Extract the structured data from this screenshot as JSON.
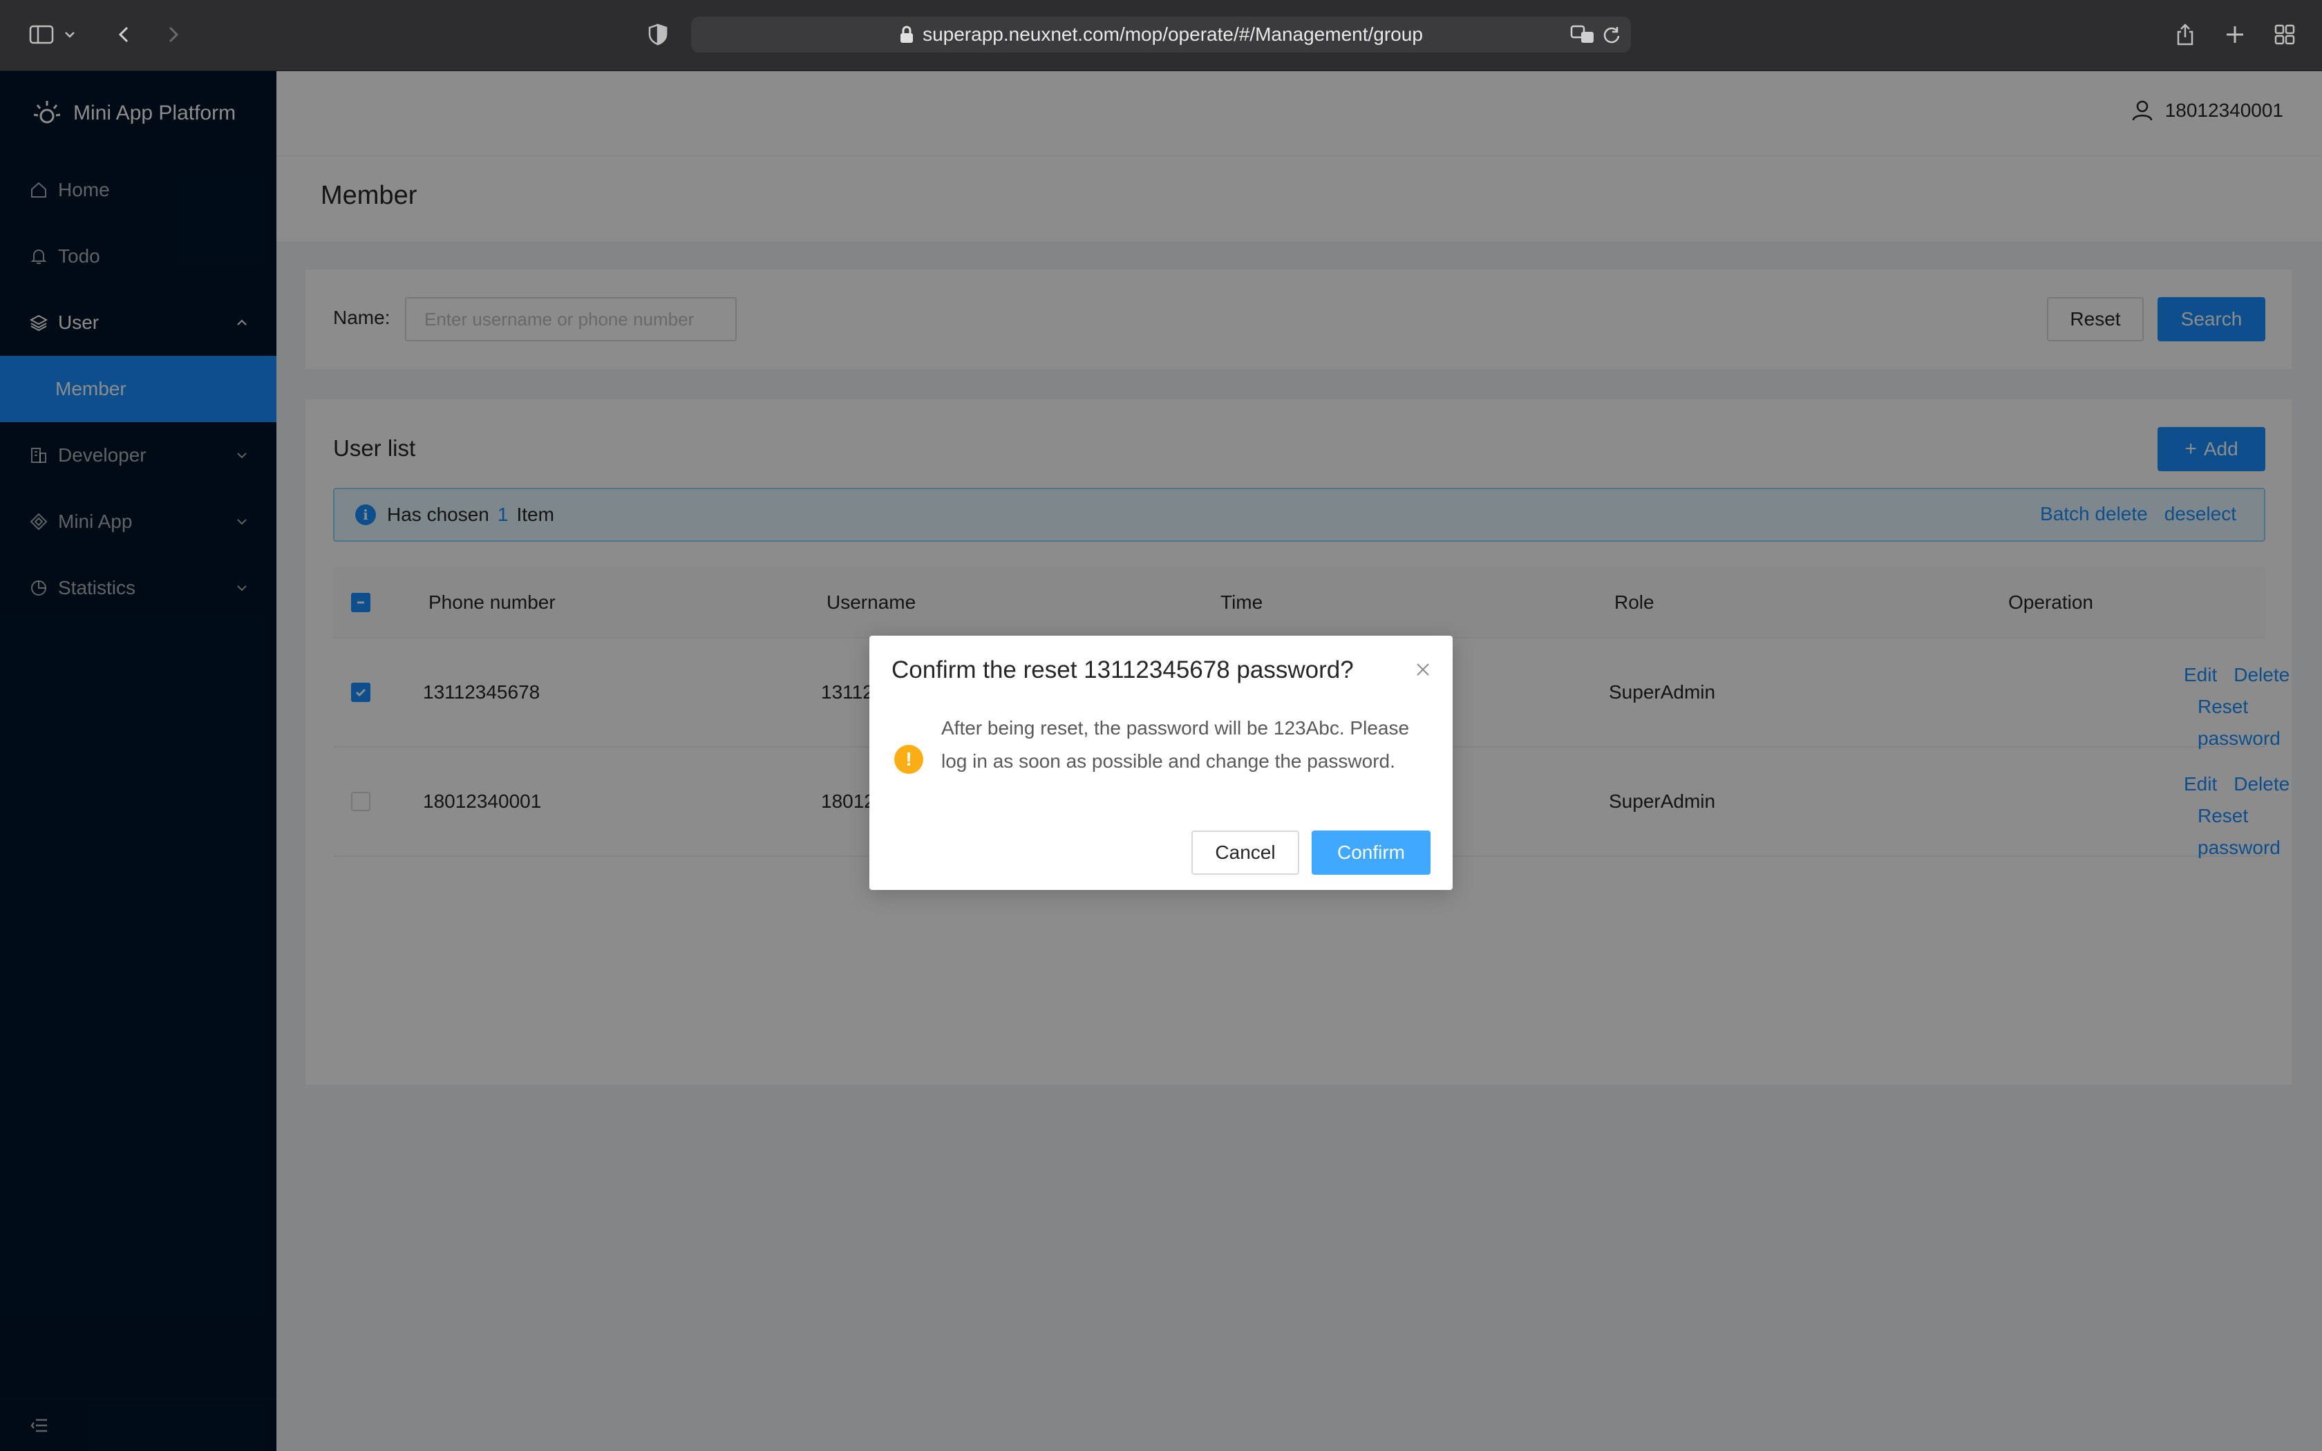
{
  "browser": {
    "url": "superapp.neuxnet.com/mop/operate/#/Management/group"
  },
  "sidebar": {
    "app_name": "Mini App Platform",
    "items": [
      {
        "label": "Home"
      },
      {
        "label": "Todo"
      },
      {
        "label": "User"
      },
      {
        "label": "Member"
      },
      {
        "label": "Developer"
      },
      {
        "label": "Mini App"
      },
      {
        "label": "Statistics"
      }
    ]
  },
  "topbar": {
    "username": "18012340001"
  },
  "page": {
    "title": "Member"
  },
  "search": {
    "label": "Name:",
    "placeholder": "Enter username or phone number",
    "reset_label": "Reset",
    "search_label": "Search"
  },
  "list": {
    "title": "User list",
    "add_label": "Add",
    "alert": {
      "prefix": "Has chosen",
      "count": "1",
      "suffix": "Item",
      "batch_delete": "Batch delete",
      "deselect": "deselect"
    },
    "columns": [
      "Phone number",
      "Username",
      "Time",
      "Role",
      "Operation"
    ],
    "rows": [
      {
        "phone": "13112345678",
        "username": "13112",
        "role": "SuperAdmin",
        "checked": true
      },
      {
        "phone": "18012340001",
        "username": "18012",
        "role": "SuperAdmin",
        "checked": false
      }
    ],
    "ops": {
      "edit": "Edit",
      "delete": "Delete",
      "reset_password": "Reset password"
    }
  },
  "modal": {
    "title": "Confirm the reset 13112345678 password?",
    "content": "After being reset, the password will be 123Abc. Please log in as soon as possible and change the password.",
    "cancel_label": "Cancel",
    "confirm_label": "Confirm",
    "warn_glyph": "!"
  },
  "colors": {
    "primary": "#1890ff",
    "sidebar_bg": "#001529",
    "warning": "#faad14"
  }
}
